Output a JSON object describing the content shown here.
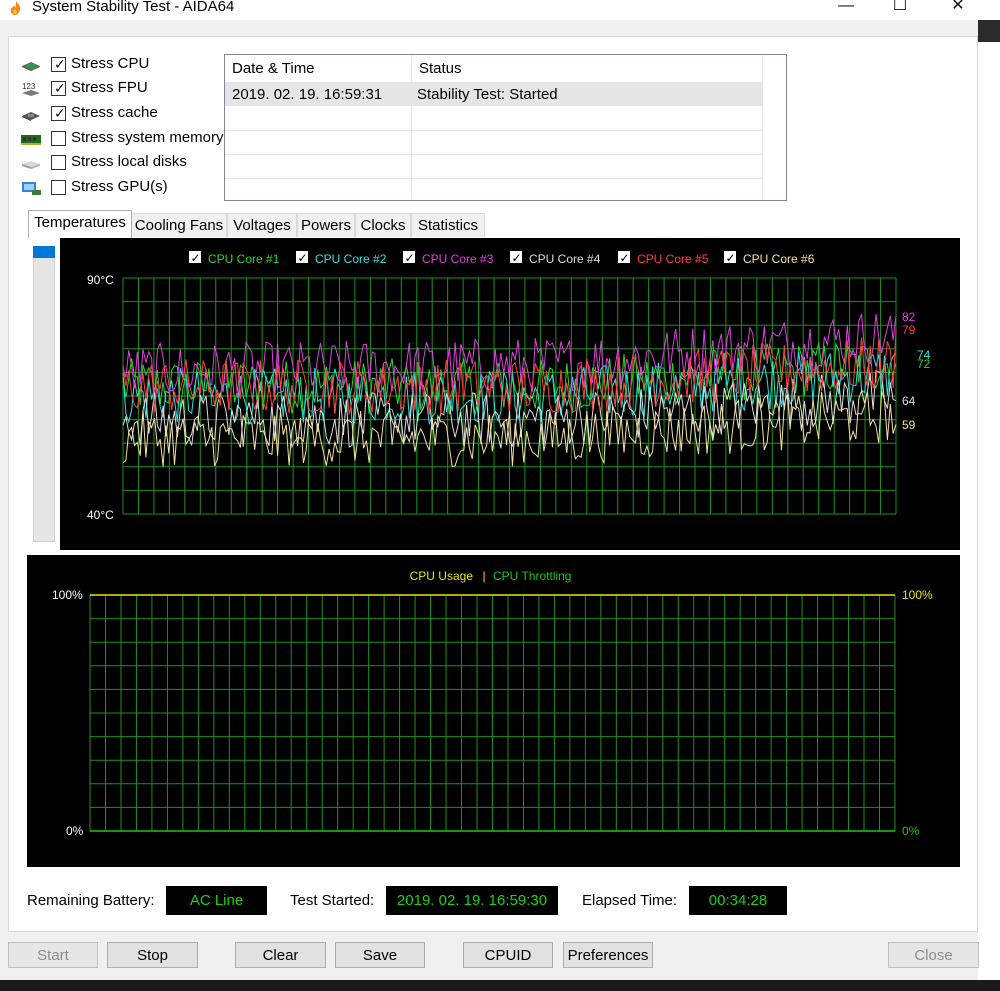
{
  "window": {
    "title": "System Stability Test - AIDA64",
    "minimize_glyph": "—",
    "maximize_glyph": "☐",
    "close_glyph": "✕"
  },
  "stress_options": [
    {
      "label": "Stress CPU",
      "checked": true,
      "icon": "cpu-chip-icon"
    },
    {
      "label": "Stress FPU",
      "checked": true,
      "icon": "fpu-123-icon"
    },
    {
      "label": "Stress cache",
      "checked": true,
      "icon": "cache-chip-icon"
    },
    {
      "label": "Stress system memory",
      "checked": false,
      "icon": "memory-module-icon"
    },
    {
      "label": "Stress local disks",
      "checked": false,
      "icon": "disk-drive-icon"
    },
    {
      "label": "Stress GPU(s)",
      "checked": false,
      "icon": "gpu-card-icon"
    }
  ],
  "log": {
    "columns": [
      "Date & Time",
      "Status"
    ],
    "rows": [
      [
        "2019. 02. 19. 16:59:31",
        "Stability Test: Started"
      ]
    ]
  },
  "tabs": [
    "Temperatures",
    "Cooling Fans",
    "Voltages",
    "Powers",
    "Clocks",
    "Statistics"
  ],
  "active_tab": "Temperatures",
  "temperature_chart": {
    "type": "line",
    "y_max_label": "90°C",
    "y_min_label": "40°C",
    "ylim": [
      40,
      90
    ],
    "grid": true,
    "grid_color": "#1f8f1f",
    "legend_position": "top",
    "series": [
      {
        "name": "CPU Core #1",
        "checked": true,
        "color": "#2bd62b",
        "current": 72
      },
      {
        "name": "CPU Core #2",
        "checked": true,
        "color": "#33e0e0",
        "current": 74
      },
      {
        "name": "CPU Core #3",
        "checked": true,
        "color": "#e040e0",
        "current": 82
      },
      {
        "name": "CPU Core #4",
        "checked": true,
        "color": "#dddddd",
        "current": 64
      },
      {
        "name": "CPU Core #5",
        "checked": true,
        "color": "#ff4040",
        "current": 79
      },
      {
        "name": "CPU Core #6",
        "checked": true,
        "color": "#f2e2a0",
        "current": 59
      }
    ]
  },
  "usage_chart": {
    "type": "line",
    "legend": {
      "usage": "CPU Usage",
      "separator": "|",
      "throttling": "CPU Throttling"
    },
    "left_max_label": "100%",
    "left_min_label": "0%",
    "right_max_label": "100%",
    "right_min_label": "0%",
    "usage_color": "#e8e800",
    "throttling_color": "#19c819",
    "usage_value": 100,
    "throttling_value": 0,
    "grid": true
  },
  "status": {
    "remaining_battery_label": "Remaining Battery:",
    "remaining_battery_value": "AC Line",
    "test_started_label": "Test Started:",
    "test_started_value": "2019. 02. 19. 16:59:30",
    "elapsed_label": "Elapsed Time:",
    "elapsed_value": "00:34:28"
  },
  "buttons": {
    "start": "Start",
    "stop": "Stop",
    "clear": "Clear",
    "save": "Save",
    "cpuid": "CPUID",
    "preferences": "Preferences",
    "close": "Close"
  },
  "chart_data": {
    "type": "line",
    "title": "",
    "ylim": [
      40,
      90
    ],
    "y_ticks": [
      "90°C",
      "40°C"
    ],
    "series": [
      {
        "name": "CPU Core #1",
        "current": 72
      },
      {
        "name": "CPU Core #2",
        "current": 74
      },
      {
        "name": "CPU Core #3",
        "current": 82
      },
      {
        "name": "CPU Core #4",
        "current": 64
      },
      {
        "name": "CPU Core #5",
        "current": 79
      },
      {
        "name": "CPU Core #6",
        "current": 59
      }
    ]
  }
}
